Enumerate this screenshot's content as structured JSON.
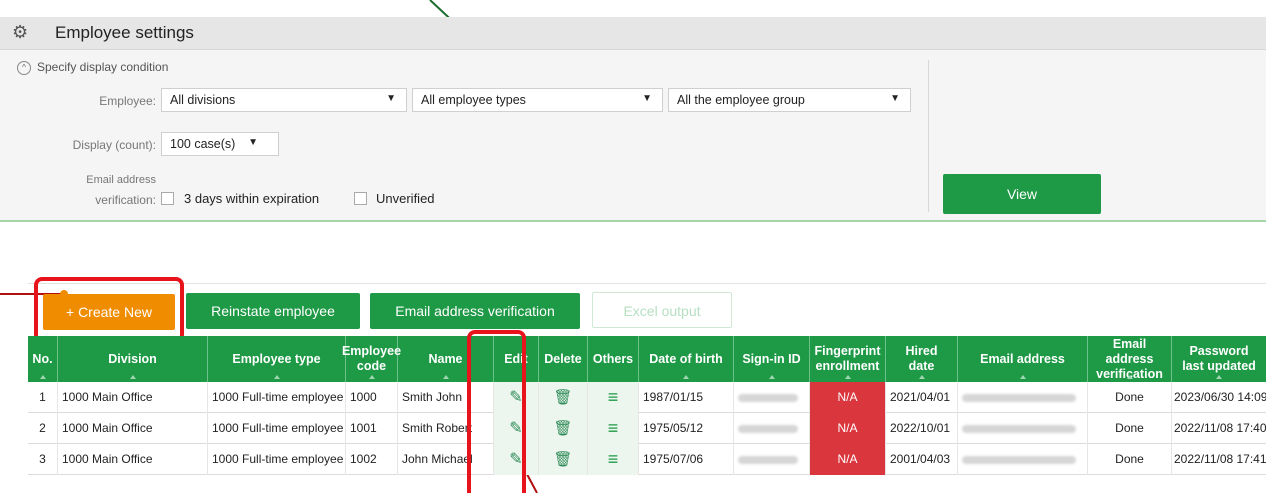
{
  "window": {
    "title": "Employee settings"
  },
  "filter": {
    "toggle_label": "Specify display condition",
    "employee_label": "Employee:",
    "division_value": "All divisions",
    "type_value": "All employee types",
    "group_value": "All the employee group",
    "display_label": "Display (count):",
    "display_value": "100 case(s)",
    "email_label_1": "Email address",
    "email_label_2": "verification:",
    "check_expiration": "3 days within expiration",
    "check_unverified": "Unverified",
    "view_button": "View"
  },
  "actions": {
    "create": "+ Create New",
    "reinstate": "Reinstate employee",
    "email_verify": "Email address verification",
    "excel": "Excel output"
  },
  "table": {
    "headers": {
      "no": "No.",
      "division": "Division",
      "type": "Employee type",
      "code_1": "Employee",
      "code_2": "code",
      "name": "Name",
      "edit": "Edit",
      "delete": "Delete",
      "others": "Others",
      "dob": "Date of birth",
      "signin": "Sign-in ID",
      "finger_1": "Fingerprint",
      "finger_2": "enrollment",
      "hired_1": "Hired",
      "hired_2": "date",
      "email": "Email address",
      "emailver_1": "Email address",
      "emailver_2": "verification",
      "pwd_1": "Password",
      "pwd_2": "last updated"
    },
    "rows": [
      {
        "no": "1",
        "division": "1000 Main Office",
        "type": "1000 Full-time employee",
        "code": "1000",
        "name": "Smith John",
        "dob": "1987/01/15",
        "finger": "N/A",
        "hired": "2021/04/01",
        "verification": "Done",
        "pwd": "2023/06/30 14:09"
      },
      {
        "no": "2",
        "division": "1000 Main Office",
        "type": "1000 Full-time employee",
        "code": "1001",
        "name": "Smith Robert",
        "dob": "1975/05/12",
        "finger": "N/A",
        "hired": "2022/10/01",
        "verification": "Done",
        "pwd": "2022/11/08 17:40"
      },
      {
        "no": "3",
        "division": "1000 Main Office",
        "type": "1000 Full-time employee",
        "code": "1002",
        "name": "John Michael",
        "dob": "1975/07/06",
        "finger": "N/A",
        "hired": "2001/04/03",
        "verification": "Done",
        "pwd": "2022/11/08 17:41"
      }
    ]
  },
  "colors": {
    "accent": "#1e9946",
    "create": "#f08c00",
    "highlight": "#e8141c",
    "na": "#d9363e"
  }
}
